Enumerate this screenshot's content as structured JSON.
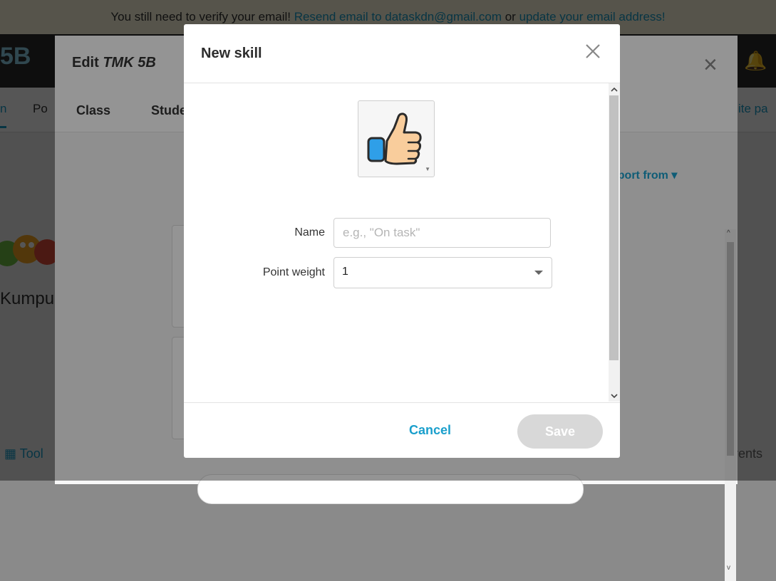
{
  "banner": {
    "prefix": "You still need to verify your email!",
    "resend_link": "Resend email to dataskdn@gmail.com",
    "or_text": " or ",
    "update_link": "update your email address!"
  },
  "app": {
    "class_short": "5B"
  },
  "page": {
    "tabs": [
      "Po",
      "n"
    ],
    "invite_link": "ite pa",
    "class_caption": "Kumpul",
    "toolkit_label": "Tool",
    "parents_label": "rents"
  },
  "edit_modal": {
    "title_prefix": "Edit",
    "class_name": "TMK 5B",
    "tabs": [
      "Class",
      "Stude"
    ],
    "import_label": "nport from"
  },
  "dialog": {
    "title": "New skill",
    "name_label": "Name",
    "name_placeholder": "e.g., \"On task\"",
    "name_value": "",
    "weight_label": "Point weight",
    "weight_value": "1",
    "cancel_label": "Cancel",
    "save_label": "Save",
    "skill_icon": "thumbs-up-icon",
    "colors": {
      "accent": "#1a9fcc",
      "save_disabled": "#d8d8d8",
      "icon_cuff": "#2f9fe8",
      "icon_hand": "#f9cd9c"
    }
  }
}
